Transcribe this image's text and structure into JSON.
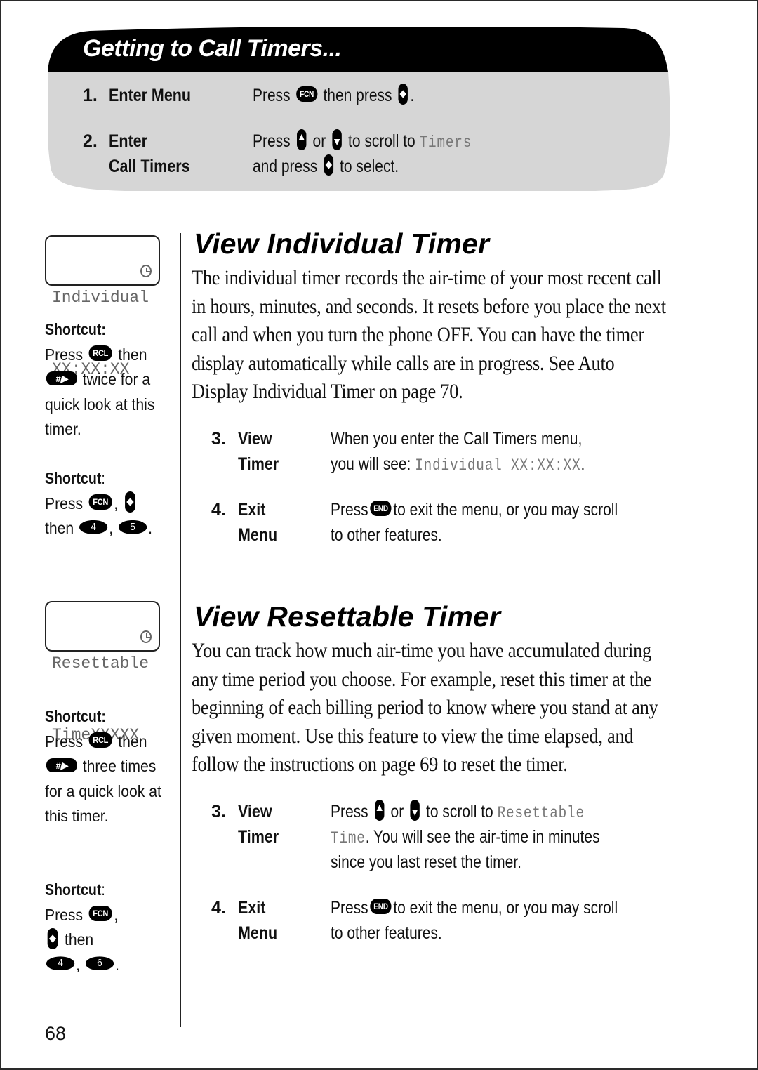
{
  "header": {
    "title": "Getting to Call Timers...",
    "colors": {
      "banner_bg": "#000000",
      "panel_bg": "#d6d6d6"
    },
    "steps": [
      {
        "number": "1.",
        "name_lines": [
          "Enter Menu"
        ],
        "desc_lines": [
          {
            "parts": [
              "Press",
              "FCN",
              "then press",
              "."
            ]
          }
        ]
      },
      {
        "number": "2.",
        "name_lines": [
          "Enter",
          "Call Timers"
        ],
        "desc_lines": [
          {
            "parts": [
              "Press",
              "or",
              "to scroll to",
              "Timers"
            ]
          },
          {
            "parts": [
              "and press",
              "to select."
            ]
          }
        ]
      }
    ]
  },
  "sidebar": {
    "individual_display": {
      "line1": "Individual",
      "line2": "XX:XX:XX"
    },
    "individual_shortcuts": [
      {
        "title": "Shortcut:",
        "parts": [
          "Press",
          "RCL",
          "then",
          "#▶",
          "twice for a quick look at this timer."
        ]
      },
      {
        "title": "Shortcut",
        "title_suffix": ":",
        "parts": [
          "Press",
          "FCN",
          ",",
          "then",
          "4",
          ",",
          "5",
          "."
        ]
      }
    ],
    "resettable_display": {
      "line1": "Resettable",
      "line2": "TimeXXXXX"
    },
    "resettable_shortcuts": [
      {
        "title": "Shortcut:",
        "parts": [
          "Press",
          "RCL",
          "then",
          "#▶",
          "three times for a quick look at this timer."
        ]
      },
      {
        "title": "Shortcut",
        "title_suffix": ":",
        "parts": [
          "Press",
          "FCN",
          ",",
          "then",
          "4",
          ",",
          "6",
          "."
        ]
      }
    ]
  },
  "sections": [
    {
      "title": "View Individual Timer",
      "body": "The individual timer records the air-time of your most recent call in hours, minutes, and seconds. It resets before you place the next call and when you turn the phone OFF. You can have the timer display automatically while calls are in progress. See Auto Display Individual Timer on page 70.",
      "steps": [
        {
          "number": "3.",
          "name_lines": [
            "View",
            "Timer"
          ],
          "desc_line1": "When you enter the Call Timers menu,",
          "desc_line2_prefix": "you will see: ",
          "desc_line2_lcd": "Individual XX:XX:XX",
          "desc_line2_suffix": "."
        },
        {
          "number": "4.",
          "name_lines": [
            "Exit",
            "Menu"
          ],
          "desc_line1_prefix": "Press",
          "desc_line1_key": "END",
          "desc_line1_suffix": "to exit the menu, or you may scroll",
          "desc_line2": "to other features."
        }
      ]
    },
    {
      "title": "View Resettable Timer",
      "body": "You can track how much air-time you have accumulated during any time period you choose. For example, reset this timer at the beginning of each billing period to know where you stand at any given moment. Use this feature to view the time elapsed, and follow the instructions on page 69 to reset the timer.",
      "steps": [
        {
          "number": "3.",
          "name_lines": [
            "View",
            "Timer"
          ],
          "desc_line1_prefix": "Press",
          "desc_line1_or": "or",
          "desc_line1_mid": "to scroll to",
          "desc_line1_lcd": "Resettable",
          "desc_line2_lcd": "Time",
          "desc_line2_suffix": ". You will see the air-time in minutes",
          "desc_line3": "since you last reset the timer."
        },
        {
          "number": "4.",
          "name_lines": [
            "Exit",
            "Menu"
          ],
          "desc_line1_prefix": "Press",
          "desc_line1_key": "END",
          "desc_line1_suffix": "to exit the menu, or you may scroll",
          "desc_line2": "to other features."
        }
      ]
    }
  ],
  "footer": {
    "page_number": "68"
  }
}
